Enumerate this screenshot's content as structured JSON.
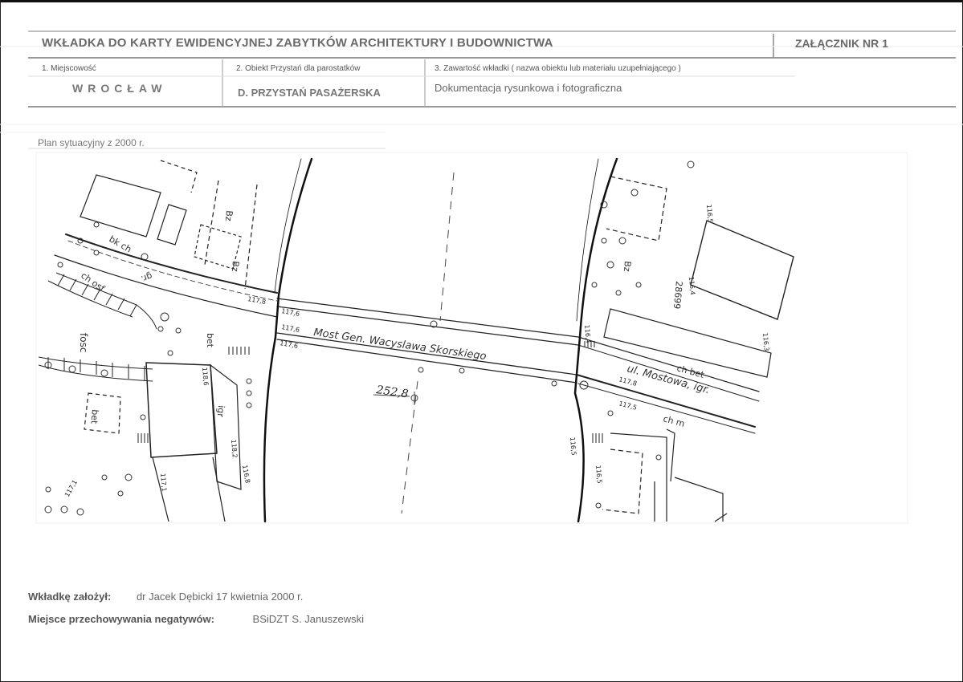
{
  "header": {
    "title": "WKŁADKA DO KARTY EWIDENCYJNEJ ZABYTKÓW ARCHITEKTURY I BUDOWNICTWA",
    "annex": "ZAŁĄCZNIK NR 1"
  },
  "fields": {
    "place_label": "1. Miejscowość",
    "place_value": "WROCŁAW",
    "object_label": "2. Obiekt Przystań dla parostatków",
    "object_value": "D. PRZYSTAŃ PASAŻERSKA",
    "content_label": "3. Zawartość wkładki ( nazwa obiektu lub materiału uzupełniającego )",
    "content_value": "Dokumentacja rysunkowa i fotograficzna"
  },
  "plan": {
    "caption": "Plan sytuacyjny z 2000 r.",
    "bridge_label": "Most Gen. Wacyslawa Skorskiego",
    "street_label": "ul. Mostowa, igr.",
    "river_height": "252,8",
    "parcel_number": "28699",
    "map_labels": [
      "fosc",
      "bet",
      "Bz",
      "Bz",
      "ch bet",
      "ch m",
      "bet",
      "ch osf",
      "bk ch",
      "gr.",
      "igr",
      "Bz"
    ],
    "height_marks": [
      "117,6",
      "117,6",
      "117,6",
      "117,8",
      "118,6",
      "118,2",
      "116,8",
      "116,5",
      "116,5",
      "116,4",
      "116,3",
      "116,5",
      "116,4",
      "117,1",
      "117,1",
      "117,5",
      "117,8"
    ]
  },
  "footer": {
    "created_label": "Wkładkę założył:",
    "created_value": "dr Jacek Dębicki 17 kwietnia 2000 r.",
    "negatives_label": "Miejsce przechowywania negatywów:",
    "negatives_value": "BSiDZT S. Januszewski"
  }
}
